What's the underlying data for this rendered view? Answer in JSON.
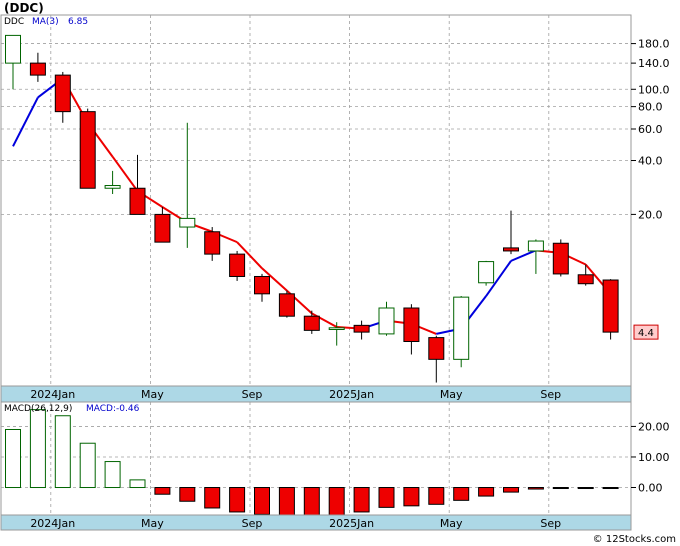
{
  "title": "(DDC)",
  "watermark": "© 12Stocks.com",
  "colors": {
    "up_outline": "#006400",
    "down_fill": "#ee0000",
    "ma_down": "#ee0000",
    "ma_up": "#0000dd",
    "axis_band": "#add8e6",
    "grid": "#a0a0a0",
    "macd_label": "#0000cc"
  },
  "chart_data": [
    {
      "type": "candlestick",
      "legend": {
        "ticker": "DDC",
        "ma_label": "MA(3)",
        "ma_value": "6.85"
      },
      "y_scale": "log",
      "y_ticks": [
        "180.0",
        "140.0",
        "100.0",
        "80.0",
        "60.0",
        "40.0",
        "20.0"
      ],
      "y_tick_values": [
        180,
        140,
        100,
        80,
        60,
        40,
        20
      ],
      "ylim": [
        2.2,
        260
      ],
      "x_labels": [
        {
          "label": "2024Jan",
          "index": 2
        },
        {
          "label": "May",
          "index": 6
        },
        {
          "label": "Sep",
          "index": 10
        },
        {
          "label": "2025Jan",
          "index": 14
        },
        {
          "label": "May",
          "index": 18
        },
        {
          "label": "Sep",
          "index": 22
        }
      ],
      "last_price": "4.4",
      "candles": [
        {
          "period": 0,
          "open": 140,
          "high": 200,
          "low": 100,
          "close": 200
        },
        {
          "period": 1,
          "open": 140,
          "high": 160,
          "low": 110,
          "close": 120
        },
        {
          "period": 2,
          "open": 120,
          "high": 125,
          "low": 65,
          "close": 75
        },
        {
          "period": 3,
          "open": 75,
          "high": 78,
          "low": 28,
          "close": 28
        },
        {
          "period": 4,
          "open": 28,
          "high": 35,
          "low": 26,
          "close": 29
        },
        {
          "period": 5,
          "open": 28,
          "high": 43,
          "low": 20,
          "close": 20
        },
        {
          "period": 6,
          "open": 20,
          "high": 22,
          "low": 14,
          "close": 14
        },
        {
          "period": 7,
          "open": 17,
          "high": 65,
          "low": 13,
          "close": 19
        },
        {
          "period": 8,
          "open": 16,
          "high": 17,
          "low": 11,
          "close": 12
        },
        {
          "period": 9,
          "open": 12,
          "high": 12.5,
          "low": 8.5,
          "close": 9
        },
        {
          "period": 10,
          "open": 9,
          "high": 9.3,
          "low": 6.5,
          "close": 7.2
        },
        {
          "period": 11,
          "open": 7.2,
          "high": 7.5,
          "low": 5.3,
          "close": 5.4
        },
        {
          "period": 12,
          "open": 5.4,
          "high": 5.8,
          "low": 4.3,
          "close": 4.5
        },
        {
          "period": 13,
          "open": 4.55,
          "high": 5.0,
          "low": 3.7,
          "close": 4.65
        },
        {
          "period": 14,
          "open": 4.8,
          "high": 5.1,
          "low": 4.0,
          "close": 4.4
        },
        {
          "period": 15,
          "open": 4.3,
          "high": 6.5,
          "low": 4.2,
          "close": 6.0
        },
        {
          "period": 16,
          "open": 6.0,
          "high": 6.3,
          "low": 3.3,
          "close": 3.9
        },
        {
          "period": 17,
          "open": 4.1,
          "high": 4.2,
          "low": 2.3,
          "close": 3.1
        },
        {
          "period": 18,
          "open": 3.1,
          "high": 7.0,
          "low": 2.8,
          "close": 6.9
        },
        {
          "period": 19,
          "open": 8.3,
          "high": 11.0,
          "low": 8.0,
          "close": 10.9
        },
        {
          "period": 20,
          "open": 13.0,
          "high": 21.0,
          "low": 12.0,
          "close": 12.5
        },
        {
          "period": 21,
          "open": 12.5,
          "high": 14.5,
          "low": 9.3,
          "close": 14.2
        },
        {
          "period": 22,
          "open": 13.8,
          "high": 14.5,
          "low": 9.0,
          "close": 9.3
        },
        {
          "period": 23,
          "open": 9.2,
          "high": 10.5,
          "low": 8.0,
          "close": 8.2
        },
        {
          "period": 24,
          "open": 8.6,
          "high": 8.7,
          "low": 4.0,
          "close": 4.4
        }
      ],
      "ma": [
        {
          "period": 0,
          "value": 48
        },
        {
          "period": 1,
          "value": 90
        },
        {
          "period": 2,
          "value": 115
        },
        {
          "period": 3,
          "value": 65
        },
        {
          "period": 4,
          "value": 42
        },
        {
          "period": 5,
          "value": 27
        },
        {
          "period": 6,
          "value": 22
        },
        {
          "period": 7,
          "value": 18
        },
        {
          "period": 8,
          "value": 16
        },
        {
          "period": 9,
          "value": 14
        },
        {
          "period": 10,
          "value": 10
        },
        {
          "period": 11,
          "value": 7.5
        },
        {
          "period": 12,
          "value": 5.6
        },
        {
          "period": 13,
          "value": 4.7
        },
        {
          "period": 14,
          "value": 4.6
        },
        {
          "period": 15,
          "value": 5.1
        },
        {
          "period": 16,
          "value": 4.9
        },
        {
          "period": 17,
          "value": 4.3
        },
        {
          "period": 18,
          "value": 4.6
        },
        {
          "period": 19,
          "value": 7.0
        },
        {
          "period": 20,
          "value": 11.0
        },
        {
          "period": 21,
          "value": 12.6
        },
        {
          "period": 22,
          "value": 12.2
        },
        {
          "period": 23,
          "value": 10.5
        },
        {
          "period": 24,
          "value": 7.2
        }
      ]
    },
    {
      "type": "bar",
      "legend": {
        "label": "MACD(26,12,9)",
        "value_label": "MACD:-0.46"
      },
      "y_ticks": [
        "20.00",
        "10.00",
        "0.00"
      ],
      "y_tick_values": [
        20,
        10,
        0
      ],
      "ylim": [
        -9,
        28
      ],
      "x_labels": [
        {
          "label": "2024Jan",
          "index": 2
        },
        {
          "label": "May",
          "index": 6
        },
        {
          "label": "Sep",
          "index": 10
        },
        {
          "label": "2025Jan",
          "index": 14
        },
        {
          "label": "May",
          "index": 18
        },
        {
          "label": "Sep",
          "index": 22
        }
      ],
      "values": [
        19,
        25.5,
        23.5,
        14.5,
        8.5,
        2.5,
        -2.2,
        -4.5,
        -6.7,
        -8,
        -8.8,
        -9,
        -9,
        -9,
        -8,
        -6.5,
        -6,
        -5.5,
        -4.2,
        -2.8,
        -1.5,
        -0.5,
        -0.3,
        -0.3,
        -0.3
      ]
    }
  ]
}
